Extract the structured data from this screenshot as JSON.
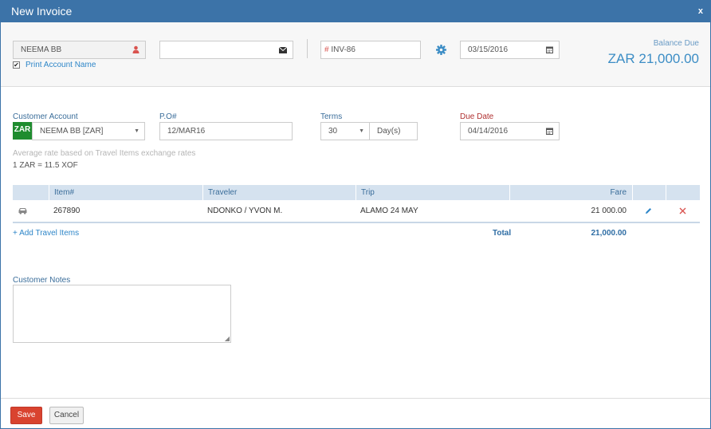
{
  "window": {
    "title": "New Invoice",
    "close_label": "x"
  },
  "top": {
    "customer_value": "NEEMA BB",
    "email_value": "",
    "invoice_prefix": "#",
    "invoice_value": "INV-86",
    "invoice_date": "03/15/2016",
    "print_account_name_label": "Print Account Name",
    "print_account_name_checked": "✔",
    "balance_due_label": "Balance Due",
    "balance_due_amount": "ZAR 21,000.00"
  },
  "form": {
    "customer_account_label": "Customer Account",
    "currency_badge": "ZAR",
    "customer_account_value": "NEEMA BB [ZAR]",
    "po_label": "P.O#",
    "po_value": "12/MAR16",
    "terms_label": "Terms",
    "terms_value": "30",
    "terms_unit": "Day(s)",
    "due_date_label": "Due Date",
    "due_date_value": "04/14/2016",
    "rate_note": "Average rate based on Travel Items exchange rates",
    "rate_value": "1 ZAR = 11.5 XOF"
  },
  "table": {
    "headers": {
      "item": "Item#",
      "traveler": "Traveler",
      "trip": "Trip",
      "fare": "Fare"
    },
    "rows": [
      {
        "item": "267890",
        "traveler": "NDONKO / YVON M.",
        "trip": "ALAMO 24 MAY",
        "fare": "21 000.00"
      }
    ],
    "add_link": "+ Add Travel Items",
    "total_label": "Total",
    "total_value": "21,000.00"
  },
  "notes": {
    "label": "Customer Notes",
    "value": ""
  },
  "buttons": {
    "save": "Save",
    "cancel": "Cancel"
  },
  "icons": {
    "customer": "user-icon",
    "email": "envelope-icon",
    "settings": "gear-icon",
    "calendar": "calendar-icon",
    "car": "car-icon",
    "edit": "pencil-icon",
    "delete": "close-icon"
  },
  "colors": {
    "title_bar": "#3c73a8",
    "save": "#d9432f",
    "badge": "#1f8c2f",
    "accent": "#3c8dc5"
  }
}
